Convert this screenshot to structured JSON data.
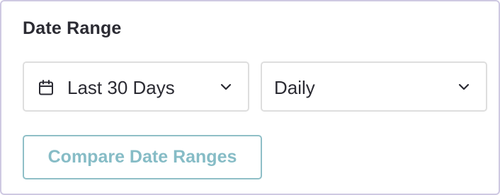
{
  "section": {
    "title": "Date Range"
  },
  "date_range_select": {
    "icon": "calendar-icon",
    "value": "Last 30 Days",
    "chevron": "chevron-down-icon"
  },
  "frequency_select": {
    "value": "Daily",
    "chevron": "chevron-down-icon"
  },
  "compare_button": {
    "label": "Compare Date Ranges"
  },
  "colors": {
    "panel_border": "#cfc9e2",
    "text": "#2b2b33",
    "select_border": "#dedede",
    "button_border": "#8fbfc7",
    "button_text": "#86bcc6"
  }
}
